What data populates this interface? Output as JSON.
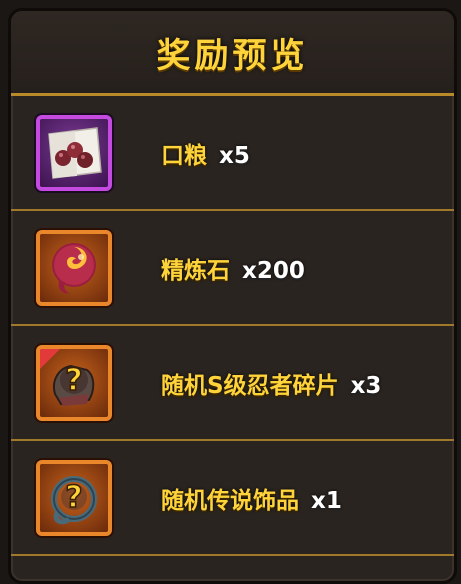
{
  "title": "奖励预览",
  "rewards": [
    {
      "name": "口粮",
      "qty": "x5",
      "icon": "ration-icon",
      "frame": "purple"
    },
    {
      "name": "精炼石",
      "qty": "x200",
      "icon": "refining-stone-icon",
      "frame": "orange"
    },
    {
      "name": "随机S级忍者碎片",
      "qty": "x3",
      "icon": "random-ninja-shard-icon",
      "frame": "orange"
    },
    {
      "name": "随机传说饰品",
      "qty": "x1",
      "icon": "random-legendary-accessory-icon",
      "frame": "orange"
    }
  ],
  "colors": {
    "title": "#ffd43a",
    "label": "#ffd43a",
    "quantity": "#ffffff",
    "divider": "#a07a2a",
    "purple_frame": "#c44ae0",
    "orange_frame": "#e9872a"
  }
}
